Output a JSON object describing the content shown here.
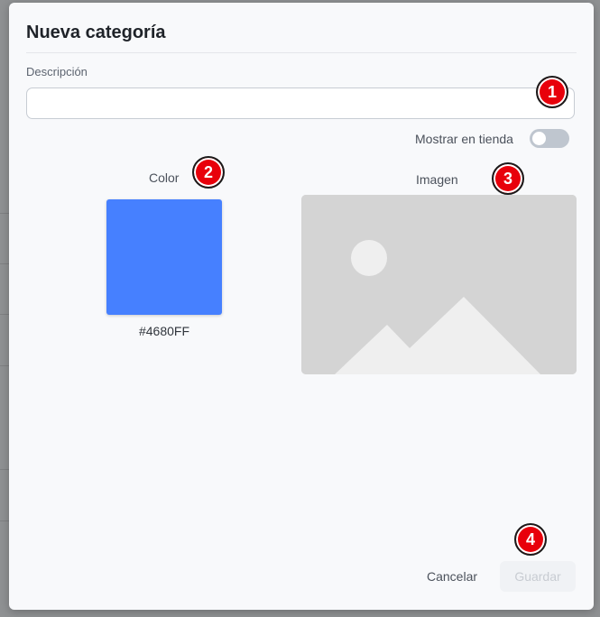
{
  "dialog": {
    "title": "Nueva categoría",
    "description": {
      "label": "Descripción",
      "value": "",
      "placeholder": ""
    },
    "show_in_store": {
      "label": "Mostrar en tienda",
      "checked": false
    },
    "color": {
      "label": "Color",
      "value": "#4680FF",
      "hex_text": "#4680FF"
    },
    "image": {
      "label": "Imagen",
      "icon": "image-placeholder-icon"
    },
    "buttons": {
      "cancel": "Cancelar",
      "save": "Guardar"
    }
  },
  "annotations": [
    "1",
    "2",
    "3",
    "4"
  ],
  "colors": {
    "dialog_bg": "#f8f9fb",
    "accent": "#4680FF",
    "toggle_off": "#bfc6cf",
    "badge": "#e8000b"
  }
}
